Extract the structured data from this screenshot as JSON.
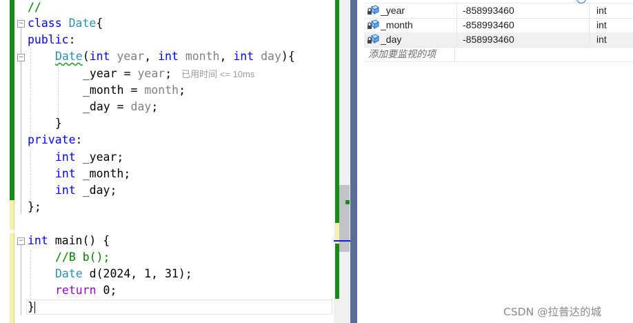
{
  "editor": {
    "lines": {
      "l1": {
        "comment": "//"
      },
      "l2": {
        "kw": "class",
        "type": "Date",
        "brace": "{"
      },
      "l3": {
        "kw": "public",
        "colon": ":"
      },
      "l4": {
        "ctor": "Date",
        "open": "(",
        "t1": "int",
        "p1": "year",
        "comma1": ", ",
        "t2": "int",
        "p2": "month",
        "comma2": ", ",
        "t3": "int",
        "p3": "day",
        "close": "){"
      },
      "l5": {
        "lhs": "_year = ",
        "rhs": "year",
        "semi": ";",
        "hint": "已用时间 <= 10ms"
      },
      "l6": {
        "lhs": "_month = ",
        "rhs": "month",
        "semi": ";"
      },
      "l7": {
        "lhs": "_day = ",
        "rhs": "day",
        "semi": ";"
      },
      "l8": {
        "text": "}"
      },
      "l9": {
        "kw": "private",
        "colon": ":"
      },
      "l10": {
        "kw": "int",
        "rest": " _year;"
      },
      "l11": {
        "kw": "int",
        "rest": " _month;"
      },
      "l12": {
        "kw": "int",
        "rest": " _day;"
      },
      "l13": {
        "text": "};"
      },
      "l14": {
        "kw": "int",
        "rest": " main() {"
      },
      "l15": {
        "comment": "//B b();"
      },
      "l16": {
        "type": "Date",
        "rest": " d(2024, 1, 31);"
      },
      "l17": {
        "kw": "return",
        "rest": " 0;"
      },
      "l18": {
        "text": "}"
      }
    },
    "fold_symbol": "−"
  },
  "watch": {
    "rows": [
      {
        "name": "_year",
        "value": "-858993460",
        "type": "int"
      },
      {
        "name": "_month",
        "value": "-858993460",
        "type": "int"
      },
      {
        "name": "_day",
        "value": "-858993460",
        "type": "int"
      }
    ],
    "add_placeholder": "添加要监视的项"
  },
  "watermark": "CSDN @拉普达的城",
  "colors": {
    "keyword": "#0000ff",
    "type": "#2b91af",
    "comment": "#008000",
    "param": "#808080",
    "control": "#8f08c4",
    "change_bar": "#1a8a1a"
  }
}
